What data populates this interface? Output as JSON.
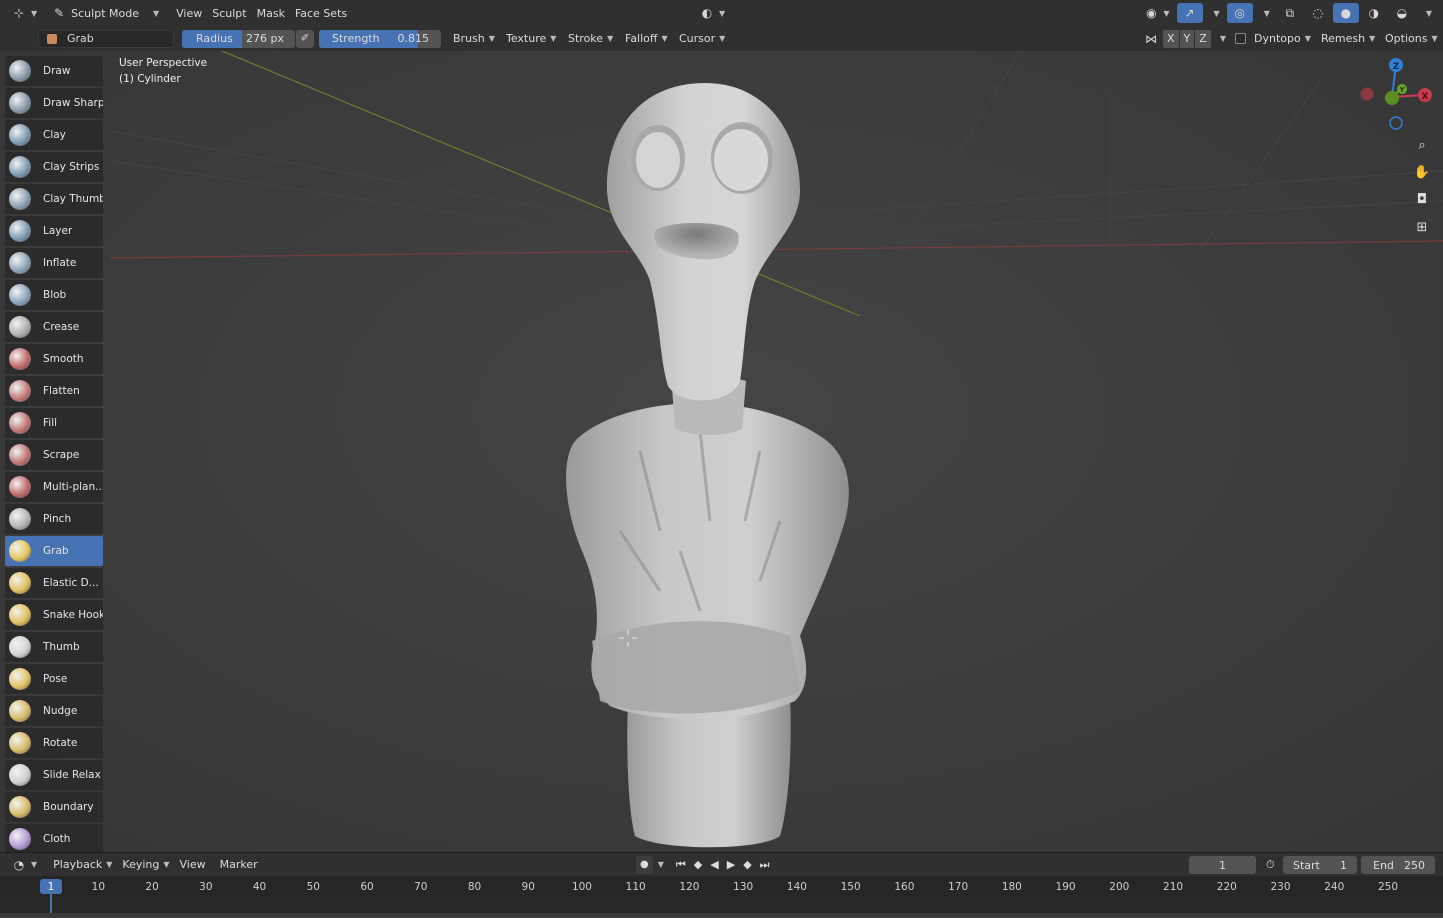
{
  "header": {
    "mode": "Sculpt Mode",
    "menus": [
      "View",
      "Sculpt",
      "Mask",
      "Face Sets"
    ]
  },
  "tool_header": {
    "active_brush": "Grab",
    "radius_label": "Radius",
    "radius_value": "276 px",
    "strength_label": "Strength",
    "strength_value": "0.815",
    "strength_fill": 0.815,
    "menus": [
      "Brush",
      "Texture",
      "Stroke",
      "Falloff",
      "Cursor"
    ],
    "axes": [
      "X",
      "Y",
      "Z"
    ],
    "dyntopo": "Dyntopo",
    "remesh": "Remesh",
    "options": "Options"
  },
  "viewport": {
    "perspective": "User Perspective",
    "object": "(1) Cylinder",
    "gizmo": {
      "z": "Z",
      "y": "Y",
      "x": "X"
    }
  },
  "tools": [
    {
      "label": "Draw",
      "color": "#8a98a8"
    },
    {
      "label": "Draw Sharp",
      "color": "#8a98a8"
    },
    {
      "label": "Clay",
      "color": "#7f9ab3"
    },
    {
      "label": "Clay Strips",
      "color": "#7f9ab3"
    },
    {
      "label": "Clay Thumb",
      "color": "#8da0b3"
    },
    {
      "label": "Layer",
      "color": "#7f9ab3"
    },
    {
      "label": "Inflate",
      "color": "#8ea3b8"
    },
    {
      "label": "Blob",
      "color": "#8aa3bd"
    },
    {
      "label": "Crease",
      "color": "#b0b0b0"
    },
    {
      "label": "Smooth",
      "color": "#c26a6a"
    },
    {
      "label": "Flatten",
      "color": "#c27a7a"
    },
    {
      "label": "Fill",
      "color": "#c07575"
    },
    {
      "label": "Scrape",
      "color": "#c07575"
    },
    {
      "label": "Multi-plan...",
      "color": "#c06a6a"
    },
    {
      "label": "Pinch",
      "color": "#b5b5b5"
    },
    {
      "label": "Grab",
      "color": "#e6c65c"
    },
    {
      "label": "Elastic D...",
      "color": "#e0c060"
    },
    {
      "label": "Snake Hook",
      "color": "#e0c060"
    },
    {
      "label": "Thumb",
      "color": "#d4d4d4"
    },
    {
      "label": "Pose",
      "color": "#e2c466"
    },
    {
      "label": "Nudge",
      "color": "#d8bc6a"
    },
    {
      "label": "Rotate",
      "color": "#d8bc6a"
    },
    {
      "label": "Slide Relax",
      "color": "#d0d0d0"
    },
    {
      "label": "Boundary",
      "color": "#d8bc6a"
    },
    {
      "label": "Cloth",
      "color": "#b49ad6"
    }
  ],
  "active_tool_index": 15,
  "timeline_header": {
    "menus": [
      "Playback",
      "Keying",
      "View",
      "Marker"
    ],
    "current_frame": "1",
    "start_label": "Start",
    "start_value": "1",
    "end_label": "End",
    "end_value": "250"
  },
  "timeline": {
    "current": "1",
    "ticks": [
      "10",
      "20",
      "30",
      "40",
      "50",
      "60",
      "70",
      "80",
      "90",
      "100",
      "110",
      "120",
      "130",
      "140",
      "150",
      "160",
      "170",
      "180",
      "190",
      "200",
      "210",
      "220",
      "230",
      "240",
      "250"
    ]
  },
  "colors": {
    "accent": "#4772b3",
    "axis_x": "#c83a4c",
    "axis_y": "#6aa527",
    "axis_z": "#2f7fd6"
  }
}
